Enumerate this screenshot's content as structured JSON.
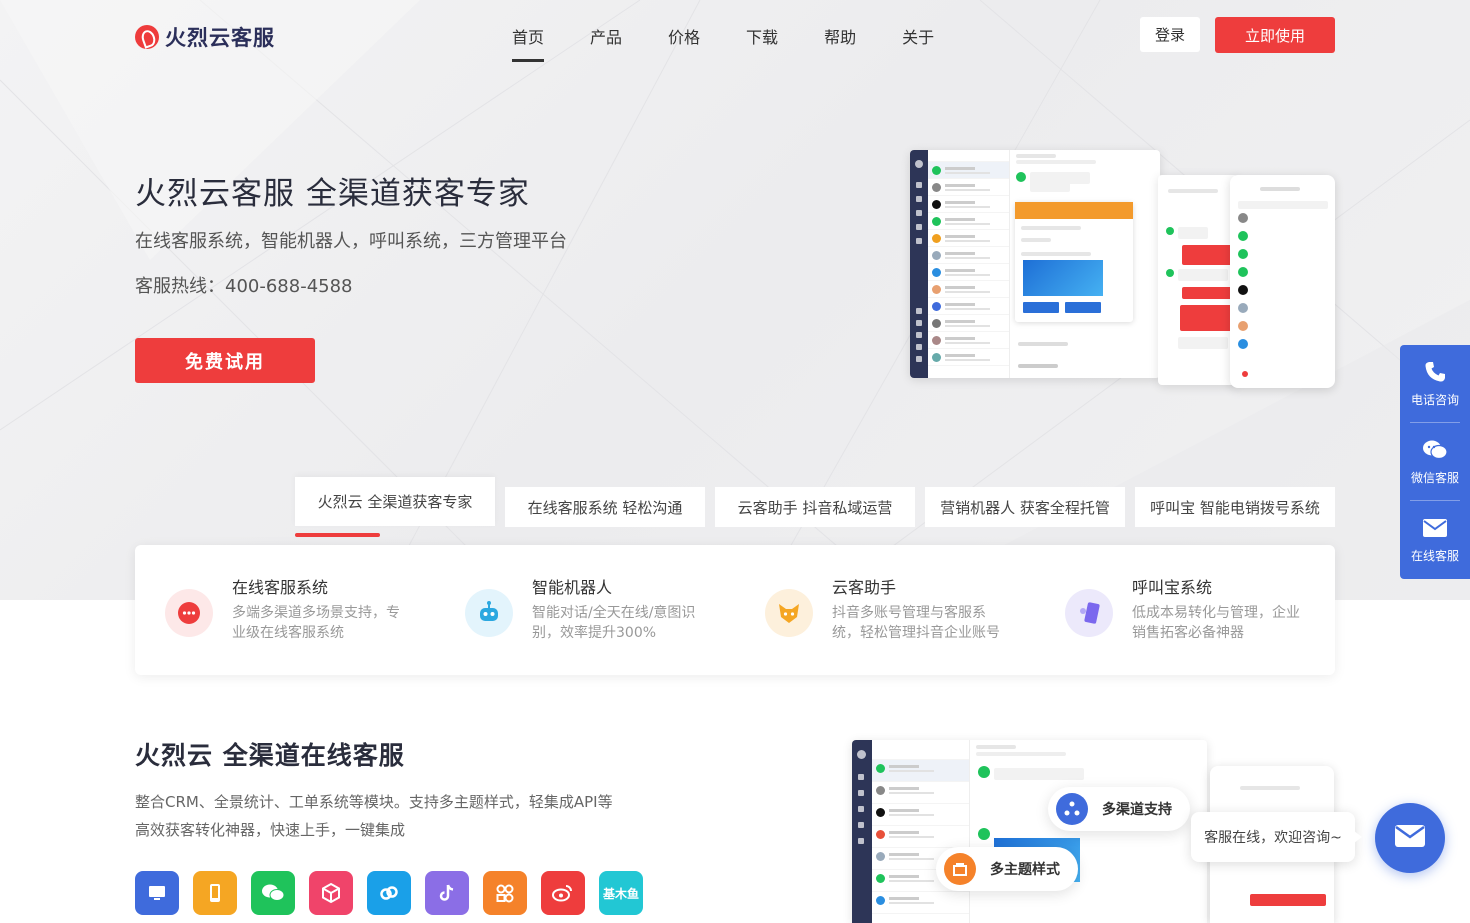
{
  "brand": {
    "name": "火烈云客服"
  },
  "nav": {
    "items": [
      {
        "label": "首页"
      },
      {
        "label": "产品"
      },
      {
        "label": "价格"
      },
      {
        "label": "下载"
      },
      {
        "label": "帮助"
      },
      {
        "label": "关于"
      }
    ],
    "login_label": "登录",
    "use_label": "立即使用"
  },
  "hero": {
    "title": "火烈云客服 全渠道获客专家",
    "subtitle": "在线客服系统，智能机器人，呼叫系统，三方管理平台",
    "hotline": "客服热线：400-688-4588",
    "trial_label": "免费试用"
  },
  "tabs": [
    {
      "label": "火烈云 全渠道获客专家"
    },
    {
      "label": "在线客服系统 轻松沟通"
    },
    {
      "label": "云客助手 抖音私域运营"
    },
    {
      "label": "营销机器人 获客全程托管"
    },
    {
      "label": "呼叫宝 智能电销拨号系统"
    }
  ],
  "features": [
    {
      "title": "在线客服系统",
      "desc": "多端多渠道多场景支持，专业级在线客服系统",
      "icon": "chat-bubble-icon",
      "color": "#ee3d3d"
    },
    {
      "title": "智能机器人",
      "desc": "智能对话/全天在线/意图识别，效率提升300%",
      "icon": "robot-icon",
      "color": "#2ca8e0"
    },
    {
      "title": "云客助手",
      "desc": "抖音多账号管理与客服系统，轻松管理抖音企业账号",
      "icon": "fox-icon",
      "color": "#f5a623"
    },
    {
      "title": "呼叫宝系统",
      "desc": "低成本易转化与管理，企业销售拓客必备神器",
      "icon": "phone-call-icon",
      "color": "#7b68ee"
    }
  ],
  "section2": {
    "title": "火烈云 全渠道在线客服",
    "desc_line1": "整合CRM、全景统计、工单系统等模块。支持多主题样式，轻集成API等",
    "desc_line2": "高效获客转化神器，快速上手，一键集成",
    "channels": [
      {
        "icon": "desktop-icon",
        "color": "#3f6bdc",
        "label": ""
      },
      {
        "icon": "mobile-icon",
        "color": "#f5a623",
        "label": ""
      },
      {
        "icon": "wechat-icon",
        "color": "#1fc35b",
        "label": ""
      },
      {
        "icon": "cube-icon",
        "color": "#f0446a",
        "label": ""
      },
      {
        "icon": "link-icon",
        "color": "#1aa0e8",
        "label": ""
      },
      {
        "icon": "tiktok-icon",
        "color": "#8b6ee6",
        "label": ""
      },
      {
        "icon": "miniapp-icon",
        "color": "#f5822a",
        "label": ""
      },
      {
        "icon": "weibo-icon",
        "color": "#ee3d3d",
        "label": ""
      },
      {
        "icon": "jimuyu-icon",
        "color": "#22c7d4",
        "label": "基木鱼"
      }
    ],
    "pill_multichannel": "多渠道支持",
    "pill_theme": "多主题样式"
  },
  "side_float": {
    "phone_label": "电话咨询",
    "wechat_label": "微信客服",
    "online_label": "在线客服"
  },
  "chat_tip": "客服在线，欢迎咨询~"
}
